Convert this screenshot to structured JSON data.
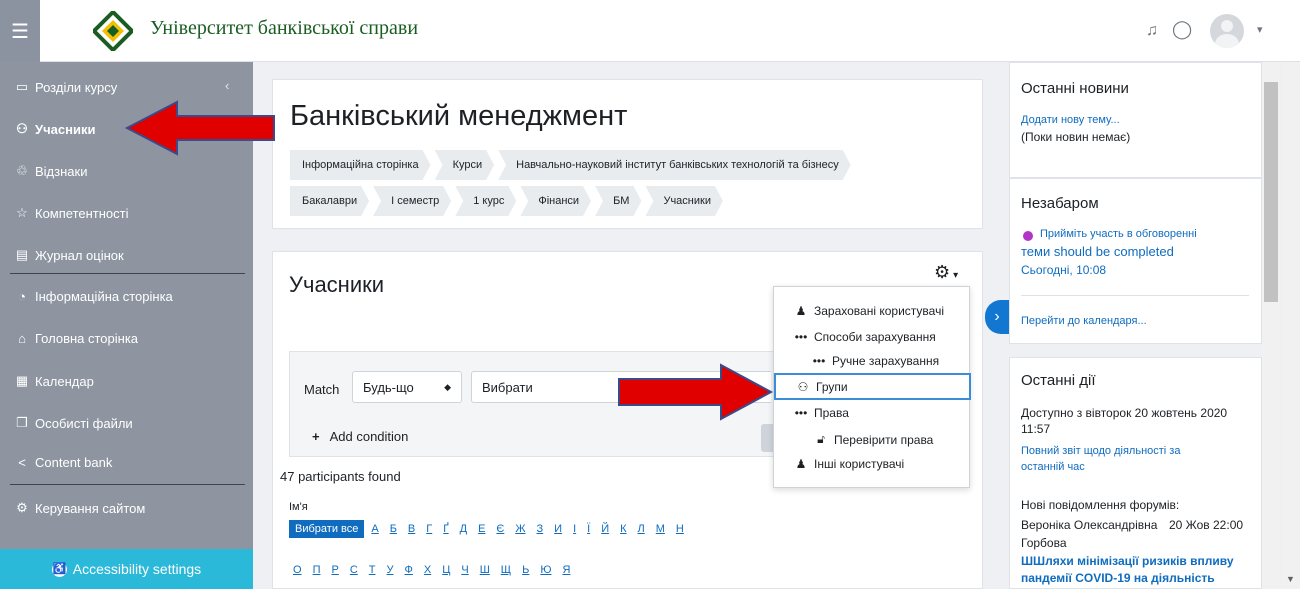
{
  "header": {
    "site_name": "Університет банківської справи",
    "menu_icon": "hamburger-icon",
    "bell_icon": "bell-icon",
    "chat_icon": "chat-bubble-icon",
    "user_icon": "user-avatar-icon",
    "caret": "▾"
  },
  "sidebar": {
    "collapse": "‹",
    "items": [
      {
        "label": "Розділи курсу",
        "icon": "folder-icon",
        "glyph": "▭"
      },
      {
        "label": "Учасники",
        "icon": "users-icon",
        "glyph": "⚇"
      },
      {
        "label": "Відзнаки",
        "icon": "badges-icon",
        "glyph": "♲"
      },
      {
        "label": "Компетентності",
        "icon": "star-icon",
        "glyph": "☆"
      },
      {
        "label": "Журнал оцінок",
        "icon": "gradebook-icon",
        "glyph": "▤"
      },
      {
        "label": "Інформаційна сторінка",
        "icon": "dashboard-icon",
        "glyph": "◔"
      },
      {
        "label": "Головна сторінка",
        "icon": "home-icon",
        "glyph": "⌂"
      },
      {
        "label": "Календар",
        "icon": "calendar-icon",
        "glyph": "▦"
      },
      {
        "label": "Особисті файли",
        "icon": "files-icon",
        "glyph": "❐"
      },
      {
        "label": "Content bank",
        "icon": "share-icon",
        "glyph": "<"
      },
      {
        "label": "Керування сайтом",
        "icon": "gear-icon",
        "glyph": "⚙"
      }
    ],
    "accessibility": "Accessibility settings"
  },
  "course": {
    "title": "Банківський менеджмент",
    "breadcrumb_row1": [
      "Інформаційна сторінка",
      "Курси",
      "Навчально-науковий інститут банківських технологій та бізнесу"
    ],
    "breadcrumb_row2": [
      "Бакалаври",
      "І семестр",
      "1 курс",
      "Фінанси",
      "БМ",
      "Учасники"
    ]
  },
  "participants": {
    "title": "Учасники",
    "match_label": "Match",
    "match_value": "Будь-що",
    "select_placeholder": "Вибрати",
    "add_condition": "Add condition",
    "found": "47 participants found",
    "name_label": "Ім'я",
    "select_all": "Вибрати все",
    "letters_row1": [
      "А",
      "Б",
      "В",
      "Г",
      "Ґ",
      "Д",
      "Е",
      "Є",
      "Ж",
      "З",
      "И",
      "І",
      "Ї",
      "Й",
      "К",
      "Л",
      "М",
      "Н"
    ],
    "letters_row2": [
      "О",
      "П",
      "Р",
      "С",
      "Т",
      "У",
      "Ф",
      "Х",
      "Ц",
      "Ч",
      "Ш",
      "Щ",
      "Ь",
      "Ю",
      "Я"
    ]
  },
  "actions_menu": {
    "items": [
      {
        "label": "Зараховані користувачі",
        "icon": "user-plus-icon"
      },
      {
        "label": "Способи зарахування",
        "icon": "ellipsis-icon"
      },
      {
        "label": "Ручне зарахування",
        "icon": "ellipsis-icon"
      },
      {
        "label": "Групи",
        "icon": "users-icon"
      },
      {
        "label": "Права",
        "icon": "ellipsis-icon"
      },
      {
        "label": "Перевірити права",
        "icon": "lock-icon"
      },
      {
        "label": "Інші користувачі",
        "icon": "user-plus-icon"
      }
    ]
  },
  "right": {
    "news_title": "Останні новини",
    "news_add": "Додати нову тему...",
    "news_none": "(Поки новин немає)",
    "upcoming_title": "Незабаром",
    "event_line1": "Прийміть участь в обговоренні",
    "event_line2": "теми should be completed",
    "event_time": "Сьогодні, 10:08",
    "goto_calendar": "Перейти до календаря...",
    "recent_title": "Останні дії",
    "available_since": "Доступно з вівторок 20 жовтень 2020",
    "available_time": "11:57",
    "full_report_1": "Повний звіт щодо діяльності за",
    "full_report_2": "останній час",
    "new_posts": "Нові повідомлення форумів:",
    "poster": "Вероніка Олександрівна",
    "poster_date": "20 Жов 22:00",
    "poster_surname": "Горбова",
    "post_title_1": "ШШляхи мінімізації ризиків впливу",
    "post_title_2": "пандемії COVID-19 на діяльність"
  },
  "colors": {
    "accent": "#0f6cbf",
    "sidebar": "#8e95a0",
    "accessibility": "#2bb9d9",
    "arrow": "#e00000",
    "logo": "#1a5d23"
  }
}
